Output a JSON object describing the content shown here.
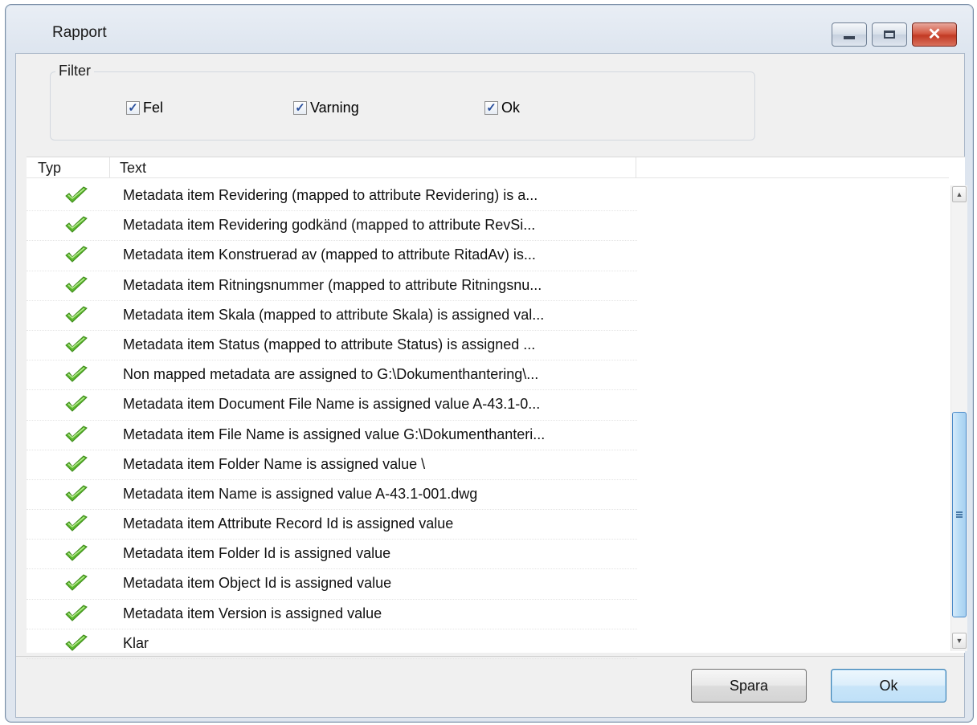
{
  "window": {
    "title": "Rapport"
  },
  "filter": {
    "legend": "Filter",
    "options": [
      {
        "label": "Fel",
        "checked": true
      },
      {
        "label": "Varning",
        "checked": true
      },
      {
        "label": "Ok",
        "checked": true
      }
    ]
  },
  "list": {
    "columns": [
      "Typ",
      "Text"
    ],
    "row_icon": "green-check-icon",
    "rows": [
      "Metadata item Revidering (mapped to attribute Revidering) is a...",
      "Metadata item Revidering godkänd (mapped to attribute RevSi...",
      "Metadata item Konstruerad av (mapped to attribute RitadAv) is...",
      "Metadata item Ritningsnummer (mapped to attribute Ritningsnu...",
      "Metadata item Skala (mapped to attribute Skala) is assigned val...",
      "Metadata item Status (mapped to attribute Status) is assigned ...",
      "Non mapped metadata are assigned to G:\\Dokumenthantering\\...",
      "Metadata item Document File Name is assigned value A-43.1-0...",
      "Metadata item File Name is assigned value G:\\Dokumenthanteri...",
      "Metadata item Folder Name is assigned value \\",
      "Metadata item Name is assigned value A-43.1-001.dwg",
      "Metadata item Attribute Record Id is assigned value",
      "Metadata item Folder Id is assigned value",
      "Metadata item Object Id is assigned value",
      "Metadata item Version is assigned value",
      "Klar"
    ]
  },
  "buttons": {
    "save": "Spara",
    "ok": "Ok"
  },
  "colors": {
    "check_green": "#5cb82e",
    "scroll_thumb": "#b8dcf6"
  }
}
